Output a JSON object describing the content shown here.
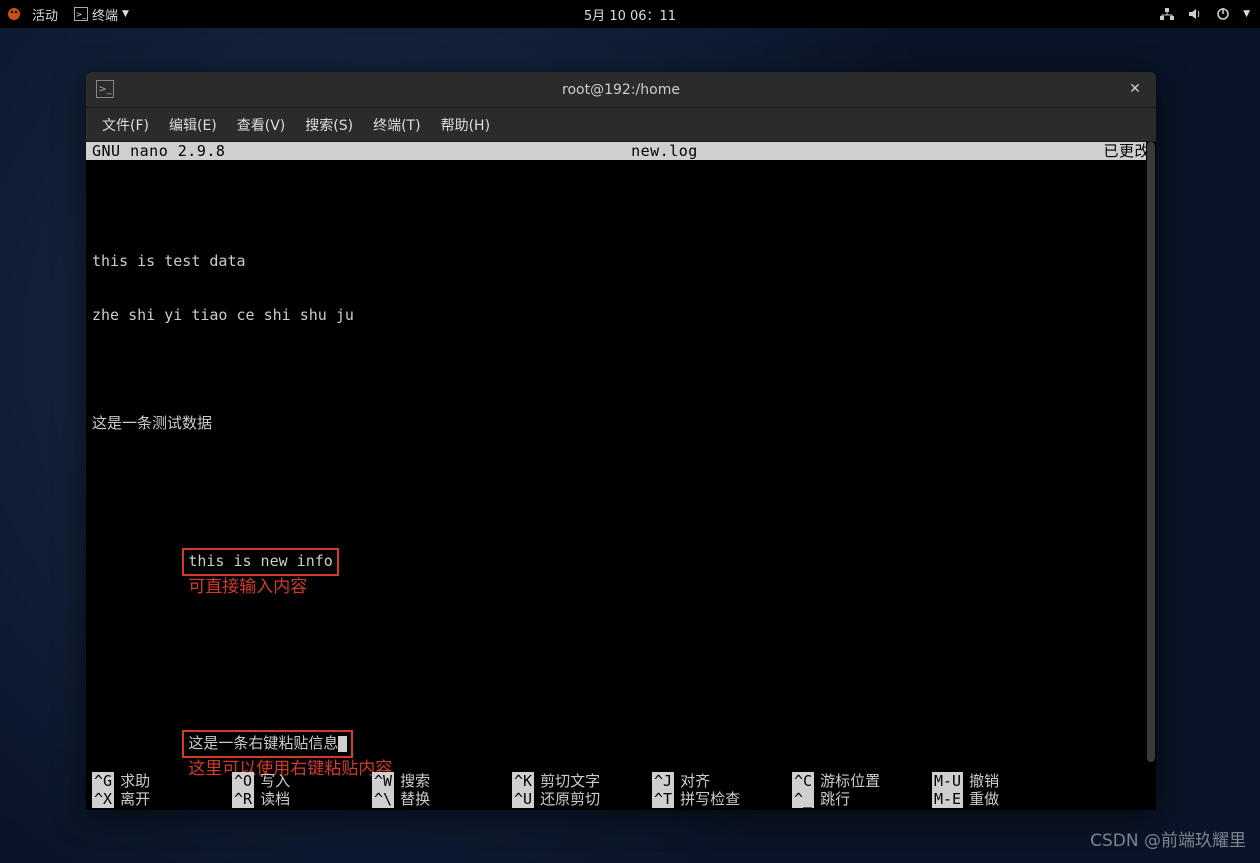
{
  "topbar": {
    "activities": "活动",
    "app_name": "终端",
    "datetime": "5月 10 06：11"
  },
  "window": {
    "title": "root@192:/home"
  },
  "menubar": {
    "file": "文件(F)",
    "edit": "编辑(E)",
    "view": "查看(V)",
    "search": "搜索(S)",
    "terminal": "终端(T)",
    "help": "帮助(H)"
  },
  "nano": {
    "app": "GNU nano 2.9.8",
    "filename": "new.log",
    "status": "已更改"
  },
  "editor": {
    "line1": "this is test data",
    "line2": "zhe shi yi tiao ce shi shu ju",
    "line3": "这是一条测试数据",
    "box1": "this is new info",
    "annot1": "可直接输入内容",
    "box2": "这是一条右键粘贴信息",
    "annot2": "这里可以使用右键粘贴内容"
  },
  "shortcuts": {
    "row1": [
      {
        "key": "^G",
        "label": "求助"
      },
      {
        "key": "^O",
        "label": "写入"
      },
      {
        "key": "^W",
        "label": "搜索"
      },
      {
        "key": "^K",
        "label": "剪切文字"
      },
      {
        "key": "^J",
        "label": "对齐"
      },
      {
        "key": "^C",
        "label": "游标位置"
      },
      {
        "key": "M-U",
        "label": "撤销"
      }
    ],
    "row2": [
      {
        "key": "^X",
        "label": "离开"
      },
      {
        "key": "^R",
        "label": "读档"
      },
      {
        "key": "^\\",
        "label": "替换"
      },
      {
        "key": "^U",
        "label": "还原剪切"
      },
      {
        "key": "^T",
        "label": "拼写检查"
      },
      {
        "key": "^_",
        "label": "跳行"
      },
      {
        "key": "M-E",
        "label": "重做"
      }
    ]
  },
  "watermark": "CSDN @前端玖耀里"
}
